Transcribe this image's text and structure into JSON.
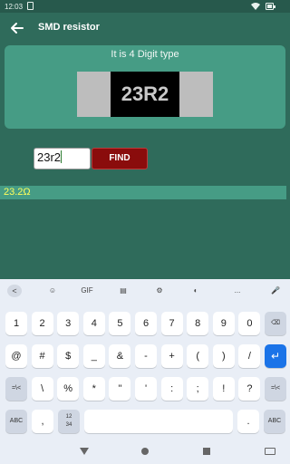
{
  "status": {
    "time": "12:03"
  },
  "appbar": {
    "title": "SMD resistor"
  },
  "card": {
    "type_text": "It is 4 Digit type",
    "resistor_code": "23R2"
  },
  "input": {
    "value": "23r2"
  },
  "find_label": "FIND",
  "result": "23.2Ω",
  "keyboard": {
    "toolbar": [
      "<",
      "☺",
      "GIF",
      "▤",
      "⚙",
      "◐",
      "...",
      "🎤"
    ],
    "rows": [
      [
        "1",
        "2",
        "3",
        "4",
        "5",
        "6",
        "7",
        "8",
        "9",
        "0",
        "⌫"
      ],
      [
        "@",
        "#",
        "$",
        "_",
        "&",
        "-",
        "+",
        "(",
        ")",
        "/",
        "↵"
      ],
      [
        "=\\<",
        "\\",
        "%",
        "*",
        "\"",
        "'",
        ":",
        ";",
        "!",
        "?",
        "=\\<"
      ],
      [
        "ABC",
        ",",
        "12\n34",
        "",
        ".",
        "ABC"
      ]
    ]
  }
}
